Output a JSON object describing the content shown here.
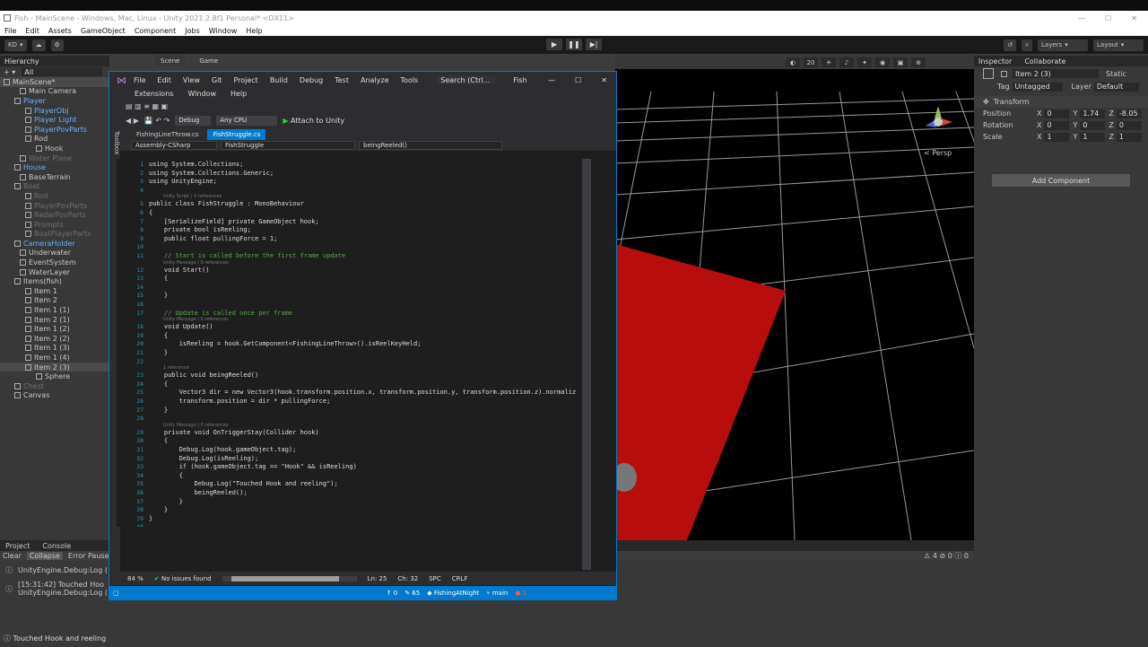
{
  "window": {
    "title": "Fish - MainScene - Windows, Mac, Linux - Unity 2021.2.8f1 Personal* <DX11>"
  },
  "menu": [
    "File",
    "Edit",
    "Assets",
    "GameObject",
    "Component",
    "Jobs",
    "Window",
    "Help"
  ],
  "toolbar": {
    "account": "KD",
    "layers": "Layers",
    "layout": "Layout"
  },
  "hierarchy": {
    "tab": "Hierarchy",
    "search": "All",
    "items": [
      {
        "label": "MainScene*",
        "indent": 0,
        "cls": "sel"
      },
      {
        "label": "Main Camera",
        "indent": 3,
        "cls": ""
      },
      {
        "label": "Player",
        "indent": 2,
        "cls": "blue"
      },
      {
        "label": "PlayerObj",
        "indent": 4,
        "cls": "blue"
      },
      {
        "label": "Player Light",
        "indent": 4,
        "cls": "blue"
      },
      {
        "label": "PlayerPovParts",
        "indent": 4,
        "cls": "blue"
      },
      {
        "label": "Rod",
        "indent": 4,
        "cls": ""
      },
      {
        "label": "Hook",
        "indent": 6,
        "cls": ""
      },
      {
        "label": "Water Plane",
        "indent": 3,
        "cls": "dim"
      },
      {
        "label": "House",
        "indent": 2,
        "cls": "blue"
      },
      {
        "label": "BaseTerrain",
        "indent": 3,
        "cls": ""
      },
      {
        "label": "Boat",
        "indent": 2,
        "cls": "dim"
      },
      {
        "label": "Rod",
        "indent": 4,
        "cls": "dim"
      },
      {
        "label": "PlayerPovParts",
        "indent": 4,
        "cls": "dim"
      },
      {
        "label": "RadarPovParts",
        "indent": 4,
        "cls": "dim"
      },
      {
        "label": "Prompts",
        "indent": 4,
        "cls": "dim"
      },
      {
        "label": "BoatPlayerParts",
        "indent": 4,
        "cls": "dim"
      },
      {
        "label": "CameraHolder",
        "indent": 2,
        "cls": "blue"
      },
      {
        "label": "Underwater",
        "indent": 3,
        "cls": ""
      },
      {
        "label": "EventSystem",
        "indent": 3,
        "cls": ""
      },
      {
        "label": "WaterLayer",
        "indent": 3,
        "cls": ""
      },
      {
        "label": "Items(fish)",
        "indent": 2,
        "cls": ""
      },
      {
        "label": "Item 1",
        "indent": 4,
        "cls": ""
      },
      {
        "label": "Item 2",
        "indent": 4,
        "cls": ""
      },
      {
        "label": "Item 1 (1)",
        "indent": 4,
        "cls": ""
      },
      {
        "label": "Item 2 (1)",
        "indent": 4,
        "cls": ""
      },
      {
        "label": "Item 1 (2)",
        "indent": 4,
        "cls": ""
      },
      {
        "label": "Item 2 (2)",
        "indent": 4,
        "cls": ""
      },
      {
        "label": "Item 1 (3)",
        "indent": 4,
        "cls": ""
      },
      {
        "label": "Item 1 (4)",
        "indent": 4,
        "cls": ""
      },
      {
        "label": "Item 2 (3)",
        "indent": 4,
        "cls": "sel"
      },
      {
        "label": "Sphere",
        "indent": 6,
        "cls": ""
      },
      {
        "label": "Chest",
        "indent": 2,
        "cls": "dim"
      },
      {
        "label": "Canvas",
        "indent": 2,
        "cls": ""
      }
    ]
  },
  "scene": {
    "tabs": [
      "Scene",
      "Game"
    ],
    "persp": "< Persp",
    "gizmo_value": "20"
  },
  "inspector": {
    "tabs": [
      "Inspector",
      "Collaborate"
    ],
    "object": "Item 2 (3)",
    "static": "Static",
    "tag_label": "Tag",
    "tag": "Untagged",
    "layer_label": "Layer",
    "layer": "Default",
    "component": "Transform",
    "rows": [
      {
        "label": "Position",
        "x": "0",
        "y": "1.74",
        "z": "-8.05"
      },
      {
        "label": "Rotation",
        "x": "0",
        "y": "0",
        "z": "0"
      },
      {
        "label": "Scale",
        "x": "1",
        "y": "1",
        "z": "1"
      }
    ],
    "add_component": "Add Component"
  },
  "console": {
    "tabs": [
      "Project",
      "Console"
    ],
    "buttons": [
      "Clear",
      "Collapse",
      "Error Pause"
    ],
    "entries": [
      {
        "line1": "UnityEngine.Debug:Log (",
        "line2": ""
      },
      {
        "line1": "[15:31:42] Touched Hoo",
        "line2": "UnityEngine.Debug:Log ("
      }
    ],
    "counts": {
      "warn": "4",
      "err": "0",
      "info": "0"
    }
  },
  "status": {
    "message": "Touched Hook and reeling"
  },
  "vs": {
    "menu1": [
      "File",
      "Edit",
      "View",
      "Git",
      "Project",
      "Build",
      "Debug",
      "Test",
      "Analyze",
      "Tools"
    ],
    "search": "Search (Ctrl...",
    "solution": "Fish",
    "menu2": [
      "Extensions",
      "Window",
      "Help"
    ],
    "config": "Debug",
    "platform": "Any CPU",
    "attach": "Attach to Unity",
    "tabs": [
      {
        "label": "FishingLineThrow.cs",
        "active": false
      },
      {
        "label": "FishStruggle.cs",
        "active": true
      }
    ],
    "nav": {
      "project": "Assembly-CSharp",
      "class": "FishStruggle",
      "member": "beingReeled()"
    },
    "toolbox": "Toolbox",
    "zoom": "84 %",
    "issues": "No issues found",
    "ln": "Ln: 25",
    "ch": "Ch: 32",
    "spc": "SPC",
    "crlf": "CRLF",
    "status": {
      "up": "0",
      "edits": "65",
      "repo": "FishingAtNight",
      "branch": "main",
      "errors": "1"
    }
  },
  "code": [
    {
      "n": "1",
      "t": "using System.Collections;"
    },
    {
      "n": "2",
      "t": "using System.Collections.Generic;"
    },
    {
      "n": "3",
      "t": "using UnityEngine;"
    },
    {
      "n": "4",
      "t": ""
    },
    {
      "n": "5",
      "t": "public class FishStruggle : MonoBehaviour",
      "hint": "Unity Script | 0 references"
    },
    {
      "n": "6",
      "t": "{"
    },
    {
      "n": "7",
      "t": "    [SerializeField] private GameObject hook;"
    },
    {
      "n": "8",
      "t": "    private bool isReeling;"
    },
    {
      "n": "9",
      "t": "    public float pullingForce = 1;"
    },
    {
      "n": "10",
      "t": ""
    },
    {
      "n": "11",
      "t": "    // Start is called before the first frame update"
    },
    {
      "n": "12",
      "t": "    void Start()",
      "hint": "Unity Message | 0 references"
    },
    {
      "n": "13",
      "t": "    {"
    },
    {
      "n": "14",
      "t": ""
    },
    {
      "n": "15",
      "t": "    }"
    },
    {
      "n": "16",
      "t": ""
    },
    {
      "n": "17",
      "t": "    // Update is called once per frame"
    },
    {
      "n": "18",
      "t": "    void Update()",
      "hint": "Unity Message | 0 references"
    },
    {
      "n": "19",
      "t": "    {"
    },
    {
      "n": "20",
      "t": "        isReeling = hook.GetComponent<FishingLineThrow>().isReelKeyHeld;"
    },
    {
      "n": "21",
      "t": "    }"
    },
    {
      "n": "22",
      "t": ""
    },
    {
      "n": "23",
      "t": "    public void beingReeled()",
      "hint": "1 reference"
    },
    {
      "n": "24",
      "t": "    {"
    },
    {
      "n": "25",
      "t": "        Vector3 dir = new Vector3(hook.transform.position.x, transform.position.y, transform.position.z).normaliz"
    },
    {
      "n": "26",
      "t": "        transform.position = dir * pullingForce;"
    },
    {
      "n": "27",
      "t": "    }"
    },
    {
      "n": "28",
      "t": ""
    },
    {
      "n": "29",
      "t": "    private void OnTriggerStay(Collider hook)",
      "hint": "Unity Message | 0 references"
    },
    {
      "n": "30",
      "t": "    {"
    },
    {
      "n": "31",
      "t": "        Debug.Log(hook.gameObject.tag);"
    },
    {
      "n": "32",
      "t": "        Debug.Log(isReeling);"
    },
    {
      "n": "33",
      "t": "        if (hook.gameObject.tag == \"Hook\" && isReeling)"
    },
    {
      "n": "34",
      "t": "        {"
    },
    {
      "n": "35",
      "t": "            Debug.Log(\"Touched Hook and reeling\");"
    },
    {
      "n": "36",
      "t": "            beingReeled();"
    },
    {
      "n": "37",
      "t": "        }"
    },
    {
      "n": "38",
      "t": "    }"
    },
    {
      "n": "39",
      "t": "}"
    },
    {
      "n": "40",
      "t": ""
    }
  ]
}
